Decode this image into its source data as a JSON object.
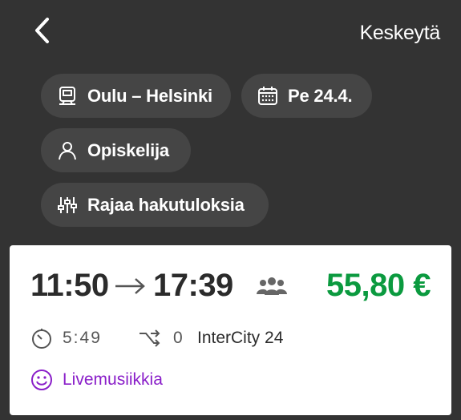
{
  "header": {
    "cancel_label": "Keskeytä"
  },
  "chips": {
    "route": "Oulu – Helsinki",
    "date": "Pe 24.4.",
    "passenger": "Opiskelija",
    "filter": "Rajaa hakutuloksia"
  },
  "result": {
    "departure": "11:50",
    "arrival": "17:39",
    "price": "55,80 €",
    "duration": "5:49",
    "transfers": "0",
    "train": "InterCity 24",
    "feature": "Livemusiikkia"
  },
  "colors": {
    "background": "#333333",
    "chip": "#454545",
    "price": "#0b9a3f",
    "feature": "#8a1fc9"
  }
}
